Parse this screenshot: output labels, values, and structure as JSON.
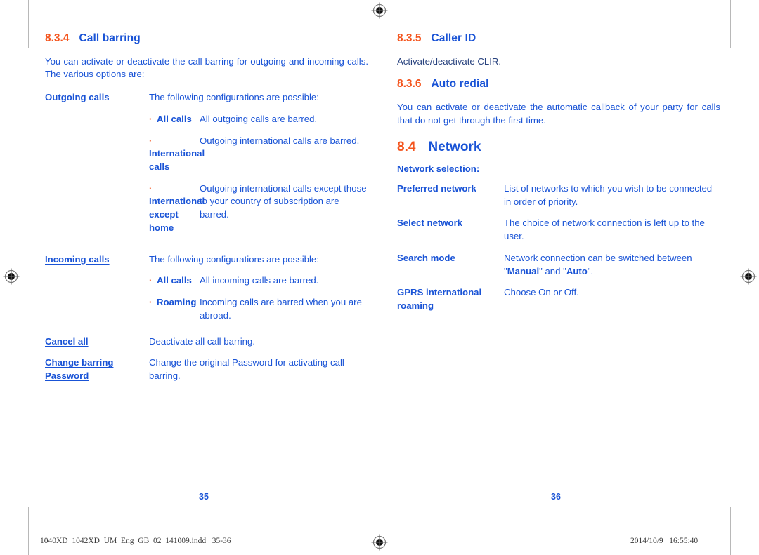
{
  "document": {
    "footer": {
      "file_name": "1040XD_1042XD_UM_Eng_GB_02_141009.indd   35-36",
      "timestamp": "2014/10/9   16:55:40"
    },
    "colors": {
      "heading_number": "#F4551E",
      "heading_title": "#1953D6",
      "body_text": "#1953D6",
      "bullet": "#F4551E",
      "crop_mark": "#b8b8b8"
    }
  },
  "left_page": {
    "folio": "35",
    "section": {
      "number": "8.3.4",
      "title": "Call barring"
    },
    "intro": "You can activate or deactivate the call barring for outgoing and incoming calls. The various options are:",
    "outgoing": {
      "term": "Outgoing calls",
      "definition": "The following configurations are possible:",
      "options": [
        {
          "term": "All calls",
          "definition": "All outgoing calls are barred."
        },
        {
          "term": "International calls",
          "definition": "Outgoing international calls are barred."
        },
        {
          "term": "International except home",
          "definition": "Outgoing international calls except those to your country of subscription are barred."
        }
      ]
    },
    "incoming": {
      "term": "Incoming calls",
      "definition": "The following configurations are possible:",
      "options": [
        {
          "term": "All calls",
          "definition": "All incoming calls are barred."
        },
        {
          "term": "Roaming",
          "definition": "Incoming calls are barred when you are abroad."
        }
      ]
    },
    "cancel_all": {
      "term": "Cancel all",
      "definition": "Deactivate all call barring."
    },
    "change_password": {
      "term": "Change barring Password",
      "definition": "Change the original Password for activating call barring."
    }
  },
  "right_page": {
    "folio": "36",
    "caller_id": {
      "number": "8.3.5",
      "title": "Caller ID",
      "body": "Activate/deactivate CLIR."
    },
    "auto_redial": {
      "number": "8.3.6",
      "title": "Auto redial",
      "body": "You can activate or deactivate the automatic callback of your party for calls that do not get through the first time."
    },
    "network": {
      "number": "8.4",
      "title": "Network",
      "subhead": "Network selection:",
      "rows": [
        {
          "term": "Preferred network",
          "definition": "List of networks to which you wish to be connected in order of priority."
        },
        {
          "term": "Select network",
          "definition": "The choice of network connection is left up to the user."
        },
        {
          "term": "Search mode",
          "definition_pre": "Network connection can be switched between \"",
          "definition_bold1": "Manual",
          "definition_mid": "\" and \"",
          "definition_bold2": "Auto",
          "definition_post": "\"."
        },
        {
          "term": "GPRS international roaming",
          "definition": "Choose On or Off."
        }
      ]
    }
  }
}
